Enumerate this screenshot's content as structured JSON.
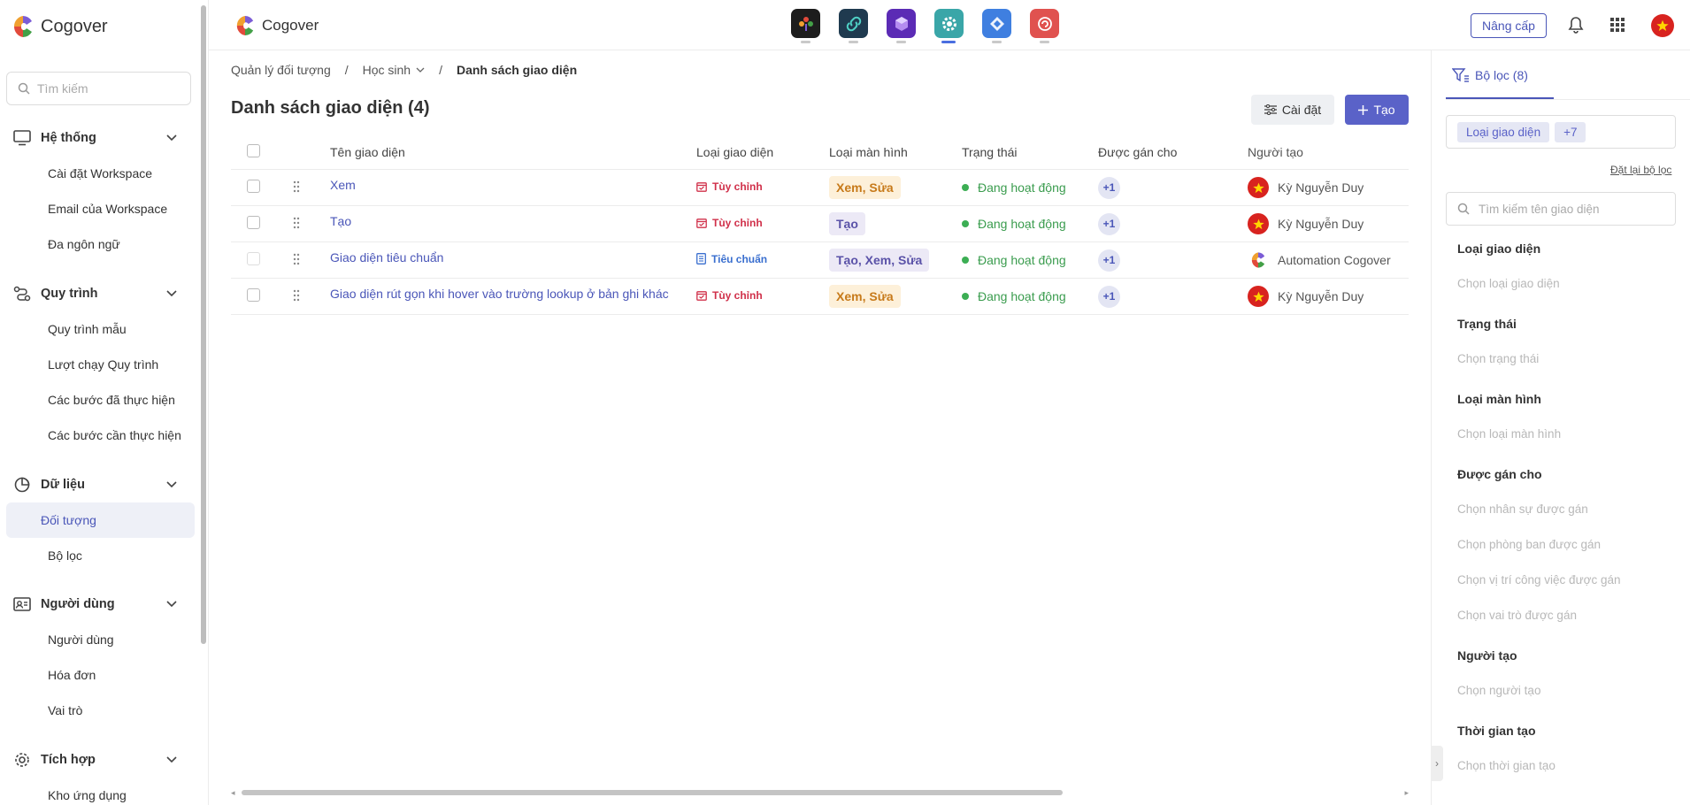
{
  "app": {
    "name": "Cogover"
  },
  "sidebar": {
    "search_placeholder": "Tìm kiếm",
    "groups": [
      {
        "label": "Hệ thống",
        "icon": "monitor-icon",
        "items": [
          "Cài đặt Workspace",
          "Email của Workspace",
          "Đa ngôn ngữ"
        ]
      },
      {
        "label": "Quy trình",
        "icon": "workflow-icon",
        "items": [
          "Quy trình mẫu",
          "Lượt chạy Quy trình",
          "Các bước đã thực hiện",
          "Các bước cần thực hiện"
        ]
      },
      {
        "label": "Dữ liệu",
        "icon": "data-icon",
        "items": [
          "Đối tượng",
          "Bộ lọc"
        ]
      },
      {
        "label": "Người dùng",
        "icon": "user-card-icon",
        "items": [
          "Người dùng",
          "Hóa đơn",
          "Vai trò"
        ]
      },
      {
        "label": "Tích hợp",
        "icon": "integration-gear-icon",
        "items": [
          "Kho ứng dụng"
        ]
      }
    ]
  },
  "topbar": {
    "title": "Cogover",
    "upgrade_label": "Nâng cấp",
    "apps": [
      {
        "name": "tree-app-icon",
        "color": "#1d1d1d"
      },
      {
        "name": "link-app-icon",
        "color": "#1f3a4f"
      },
      {
        "name": "cube-app-icon",
        "color": "#5b2bb5"
      },
      {
        "name": "settings-app-icon",
        "color": "#3aa6a8"
      },
      {
        "name": "diamond-app-icon",
        "color": "#3f7fe0"
      },
      {
        "name": "support-app-icon",
        "color": "#e0524f"
      }
    ]
  },
  "breadcrumb": {
    "items": [
      "Quản lý đối tượng",
      "Học sinh",
      "Danh sách giao diện"
    ],
    "separator": "/"
  },
  "page": {
    "title": "Danh sách giao diện (4)",
    "settings_label": "Cài đặt",
    "create_label": "Tạo"
  },
  "table": {
    "columns": [
      "Tên giao diện",
      "Loại giao diện",
      "Loại màn hình",
      "Trạng thái",
      "Được gán cho",
      "Người tạo"
    ],
    "rows": [
      {
        "name": "Xem",
        "type": "Tùy chỉnh",
        "type_kind": "custom",
        "screen": "Xem, Sửa",
        "screen_color": "orange",
        "status": "Đang hoạt động",
        "assigned": "+1",
        "creator": "Kỳ Nguyễn Duy",
        "creator_avatar": "flag"
      },
      {
        "name": "Tạo",
        "type": "Tùy chỉnh",
        "type_kind": "custom",
        "screen": "Tạo",
        "screen_color": "purple",
        "status": "Đang hoạt động",
        "assigned": "+1",
        "creator": "Kỳ Nguyễn Duy",
        "creator_avatar": "flag"
      },
      {
        "name": "Giao diện tiêu chuẩn",
        "type": "Tiêu chuẩn",
        "type_kind": "std",
        "screen": "Tạo, Xem, Sửa",
        "screen_color": "purple",
        "status": "Đang hoạt động",
        "assigned": "+1",
        "creator": "Automation Cogover",
        "creator_avatar": "logo"
      },
      {
        "name": "Giao diện rút gọn khi hover vào trường lookup ở bản ghi khác",
        "type": "Tùy chỉnh",
        "type_kind": "custom",
        "screen": "Xem, Sửa",
        "screen_color": "orange",
        "status": "Đang hoạt động",
        "assigned": "+1",
        "creator": "Kỳ Nguyễn Duy",
        "creator_avatar": "flag"
      }
    ]
  },
  "filter_panel": {
    "tab_label": "Bộ lọc (8)",
    "chips": [
      "Loại giao diện",
      "+7"
    ],
    "reset_label": "Đặt lại bộ lọc",
    "search_placeholder": "Tìm kiếm tên giao diện",
    "sections": [
      {
        "title": "Loại giao diện",
        "options": [
          "Chọn loại giao diện"
        ]
      },
      {
        "title": "Trạng thái",
        "options": [
          "Chọn trạng thái"
        ]
      },
      {
        "title": "Loại màn hình",
        "options": [
          "Chọn loại màn hình"
        ]
      },
      {
        "title": "Được gán cho",
        "options": [
          "Chọn nhân sự được gán",
          "Chọn phòng ban được gán",
          "Chọn vị trí công việc được gán",
          "Chọn vai trò được gán"
        ]
      },
      {
        "title": "Người tạo",
        "options": [
          "Chọn người tạo"
        ]
      },
      {
        "title": "Thời gian tạo",
        "options": [
          "Chọn thời gian tạo"
        ]
      }
    ]
  },
  "colors": {
    "accent": "#5a62c8",
    "link": "#4a56b8",
    "active_status": "#3cae54"
  }
}
